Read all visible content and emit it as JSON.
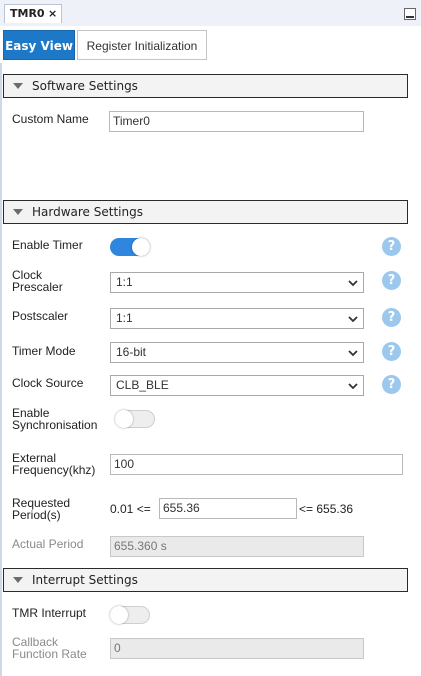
{
  "doc_tab": {
    "title": "TMR0",
    "close": "×"
  },
  "view_tabs": {
    "easy": "Easy View",
    "register": "Register Initialization"
  },
  "software": {
    "header": "Software Settings",
    "custom_name_label": "Custom Name",
    "custom_name_value": "Timer0"
  },
  "hardware": {
    "header": "Hardware Settings",
    "enable_timer_label": "Enable Timer",
    "enable_timer_on": true,
    "clock_prescaler_label_1": "Clock",
    "clock_prescaler_label_2": "Prescaler",
    "clock_prescaler_value": "1:1",
    "postscaler_label": "Postscaler",
    "postscaler_value": "1:1",
    "timer_mode_label": "Timer Mode",
    "timer_mode_value": "16-bit",
    "clock_source_label": "Clock Source",
    "clock_source_value": "CLB_BLE",
    "enable_sync_label_1": "Enable",
    "enable_sync_label_2": "Synchronisation",
    "enable_sync_on": false,
    "ext_freq_label_1": "External",
    "ext_freq_label_2": "Frequency(khz)",
    "ext_freq_value": "100",
    "req_period_label_1": "Requested",
    "req_period_label_2": "Period(s)",
    "req_period_min": "0.01 <=",
    "req_period_value": "655.36",
    "req_period_max": "<= 655.36",
    "actual_period_label": "Actual Period",
    "actual_period_value": "655.360 s"
  },
  "interrupt": {
    "header": "Interrupt Settings",
    "tmr_interrupt_label": "TMR Interrupt",
    "tmr_interrupt_on": false,
    "callback_label_1": "Callback",
    "callback_label_2": "Function Rate",
    "callback_value": "0"
  },
  "icons": {
    "help": "?",
    "section_toggle": "collapse-triangle",
    "dropdown": "chevron-down"
  },
  "colors": {
    "accent": "#1e78c8",
    "toggle_on": "#2e86de",
    "help": "#9cc8ee"
  }
}
